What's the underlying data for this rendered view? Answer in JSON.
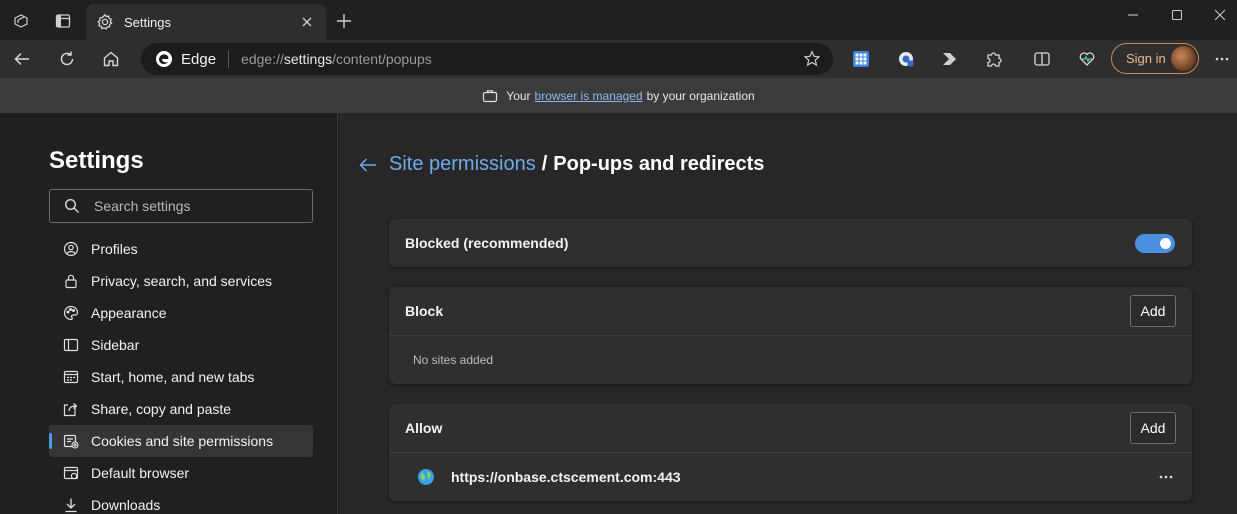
{
  "tab": {
    "title": "Settings"
  },
  "addressbar": {
    "brand": "Edge",
    "url_prefix": "edge://",
    "url_host": "settings",
    "url_path": "/content/popups"
  },
  "toolbar": {
    "signin_label": "Sign in"
  },
  "managed": {
    "prefix": "Your",
    "link": "browser is managed",
    "suffix": "by your organization"
  },
  "sidebar": {
    "title": "Settings",
    "search_placeholder": "Search settings",
    "items": [
      {
        "label": "Profiles",
        "icon": "profile-icon"
      },
      {
        "label": "Privacy, search, and services",
        "icon": "lock-icon"
      },
      {
        "label": "Appearance",
        "icon": "palette-icon"
      },
      {
        "label": "Sidebar",
        "icon": "sidebar-icon"
      },
      {
        "label": "Start, home, and new tabs",
        "icon": "newtab-icon"
      },
      {
        "label": "Share, copy and paste",
        "icon": "share-icon"
      },
      {
        "label": "Cookies and site permissions",
        "icon": "cookies-icon",
        "active": true
      },
      {
        "label": "Default browser",
        "icon": "browser-icon"
      },
      {
        "label": "Downloads",
        "icon": "download-icon"
      }
    ]
  },
  "main": {
    "breadcrumb_parent": "Site permissions",
    "breadcrumb_sep": "/",
    "breadcrumb_current": "Pop-ups and redirects",
    "blocked_label": "Blocked (recommended)",
    "blocked_on": true,
    "block_section": {
      "title": "Block",
      "add_label": "Add",
      "empty_text": "No sites added"
    },
    "allow_section": {
      "title": "Allow",
      "add_label": "Add",
      "sites": [
        "https://onbase.ctscement.com:443"
      ]
    }
  },
  "colors": {
    "accent": "#4c9bf0",
    "link": "#6ea9ec",
    "signin": "#f0b58a"
  }
}
